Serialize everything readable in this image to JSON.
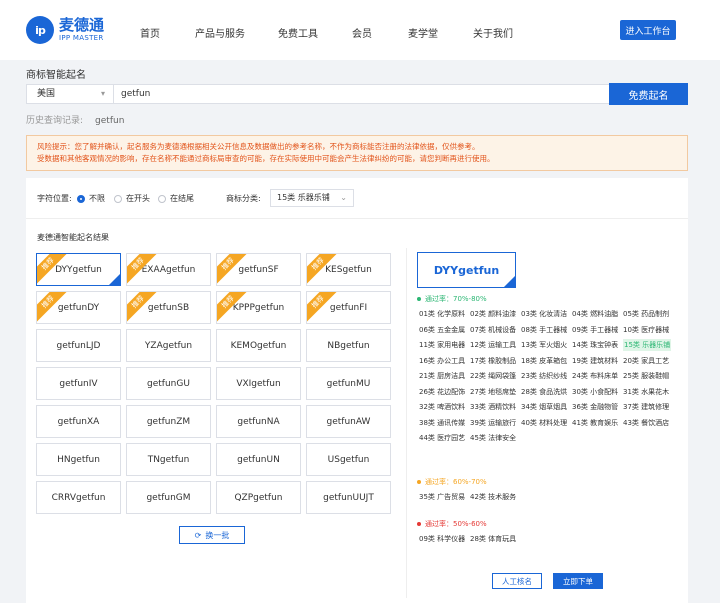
{
  "header": {
    "logo_cn": "麦德通",
    "logo_en": "IPP MASTER",
    "logo_mark": "ip",
    "nav": [
      "首页",
      "产品与服务",
      "免费工具",
      "会员",
      "麦学堂",
      "关于我们"
    ],
    "workbench_button": "进入工作台"
  },
  "search": {
    "section_title": "商标智能起名",
    "country": "美国",
    "query": "getfun",
    "submit_label": "免费起名",
    "history_label": "历史查询记录:",
    "history_item": "getfun"
  },
  "notice": {
    "line1": "风险提示：您了解并确认，起名服务为麦德通根据相关公开信息及数据做出的参考名称，不作为商标能否注册的法律依据，仅供参考。",
    "line2": "受数据和其他客观情况的影响，存在名称不能通过商标局审查的可能，存在实际使用中可能会产生法律纠纷的可能，请您判断再进行使用。"
  },
  "filters": {
    "position_label": "字符位置:",
    "options": [
      "不限",
      "在开头",
      "在结尾"
    ],
    "selected": "不限",
    "category_label": "商标分类:",
    "category_value": "15类 乐器乐铺"
  },
  "results": {
    "title": "麦德通智能起名结果",
    "badge": "推荐",
    "names": [
      {
        "name": "DYYgetfun",
        "recommended": true,
        "selected": true
      },
      {
        "name": "EXAAgetfun",
        "recommended": true
      },
      {
        "name": "getfunSF",
        "recommended": true
      },
      {
        "name": "KESgetfun",
        "recommended": true
      },
      {
        "name": "getfunDY",
        "recommended": true
      },
      {
        "name": "getfunSB",
        "recommended": true
      },
      {
        "name": "KPPPgetfun",
        "recommended": true
      },
      {
        "name": "getfunFI",
        "recommended": true
      },
      {
        "name": "getfunLJD"
      },
      {
        "name": "YZAgetfun"
      },
      {
        "name": "KEMOgetfun"
      },
      {
        "name": "NBgetfun"
      },
      {
        "name": "getfunIV"
      },
      {
        "name": "getfunGU"
      },
      {
        "name": "VXIgetfun"
      },
      {
        "name": "getfunMU"
      },
      {
        "name": "getfunXA"
      },
      {
        "name": "getfunZM"
      },
      {
        "name": "getfunNA"
      },
      {
        "name": "getfunAW"
      },
      {
        "name": "HNgetfun"
      },
      {
        "name": "TNgetfun"
      },
      {
        "name": "getfunUN"
      },
      {
        "name": "USgetfun"
      },
      {
        "name": "CRRVgetfun"
      },
      {
        "name": "getfunGM"
      },
      {
        "name": "QZPgetfun"
      },
      {
        "name": "getfunUUJT"
      }
    ],
    "refresh_label": "换一批",
    "refresh_icon": "refresh-icon"
  },
  "detail": {
    "selected_name": "DYYgetfun",
    "groups": [
      {
        "label": "通过率：70%-80%",
        "color": "#2bb673",
        "classes": [
          "01类 化学原料",
          "02类 颜料油漆",
          "03类 化妆清洁",
          "04类 燃料油脂",
          "05类 药品制剂",
          "06类 五金金属",
          "07类 机械设备",
          "08类 手工器械",
          "09类 手工器械",
          "10类 医疗器械",
          "11类 家用电器",
          "12类 运输工具",
          "13类 军火烟火",
          "14类 珠宝钟表",
          "15类 乐器乐铺",
          "16类 办公工具",
          "17类 橡胶制品",
          "18类 皮革箱包",
          "19类 建筑材料",
          "20类 家具工艺",
          "21类 厨房洁具",
          "22类 绳网袋篷",
          "23类 纺织纱线",
          "24类 布料床单",
          "25类 服装鞋帽",
          "26类 花边配饰",
          "27类 地毯席垫",
          "28类 食品洗烘",
          "30类 小食配料",
          "31类 水果花木",
          "32类 啤酒饮料",
          "33类 酒精饮料",
          "34类 烟草烟具",
          "36类 金融物管",
          "37类 建筑修理",
          "38类 通讯传媒",
          "39类 运输旅行",
          "40类 材料处理",
          "41类 教育娱乐",
          "43类 餐饮酒店",
          "44类 医疗园艺",
          "45类 法律安全"
        ],
        "active": "15类 乐器乐铺"
      },
      {
        "label": "通过率：60%-70%",
        "color": "#f5a623",
        "classes": [
          "35类 广告贸易",
          "42类 技术服务"
        ]
      },
      {
        "label": "通过率：50%-60%",
        "color": "#e53935",
        "classes": [
          "09类 科学仪器",
          "28类 体育玩具"
        ]
      }
    ],
    "human_button": "人工核名",
    "order_button": "立即下单"
  }
}
